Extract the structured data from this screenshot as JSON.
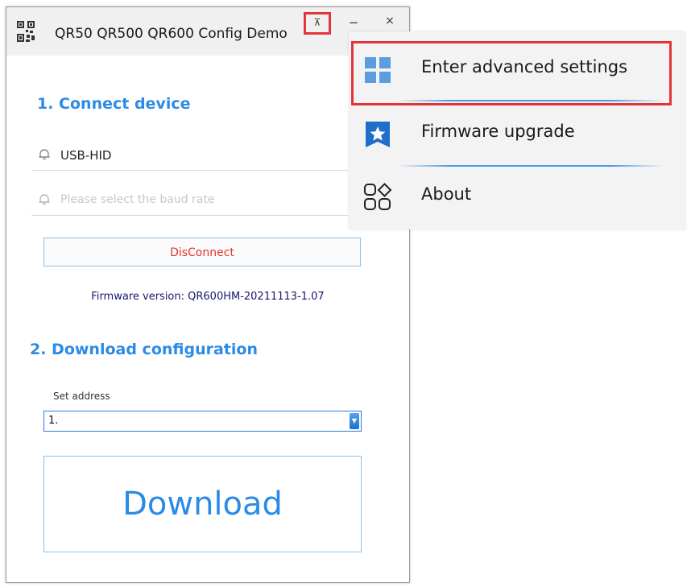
{
  "window": {
    "title": "QR50 QR500 QR600 Config Demo",
    "controls": {
      "pin": "⊼",
      "minimize": "−",
      "close": "×"
    }
  },
  "connect": {
    "heading": "1. Connect device",
    "interface_value": "USB-HID",
    "baud_placeholder": "Please select the baud rate",
    "disconnect_label": "DisConnect",
    "firmware_version": "Firmware version: QR600HM-20211113-1.07"
  },
  "download": {
    "heading": "2. Download configuration",
    "address_label": "Set address",
    "address_value": "1.",
    "button_label": "Download"
  },
  "menu": {
    "items": [
      {
        "label": "Enter advanced settings",
        "icon": "grid-icon"
      },
      {
        "label": "Firmware upgrade",
        "icon": "star-icon"
      },
      {
        "label": "About",
        "icon": "shapes-icon"
      }
    ]
  },
  "colors": {
    "accent": "#2b8be6",
    "highlight": "#e1343c",
    "disconnect_text": "#e3342f",
    "firmware_text": "#17156f"
  }
}
